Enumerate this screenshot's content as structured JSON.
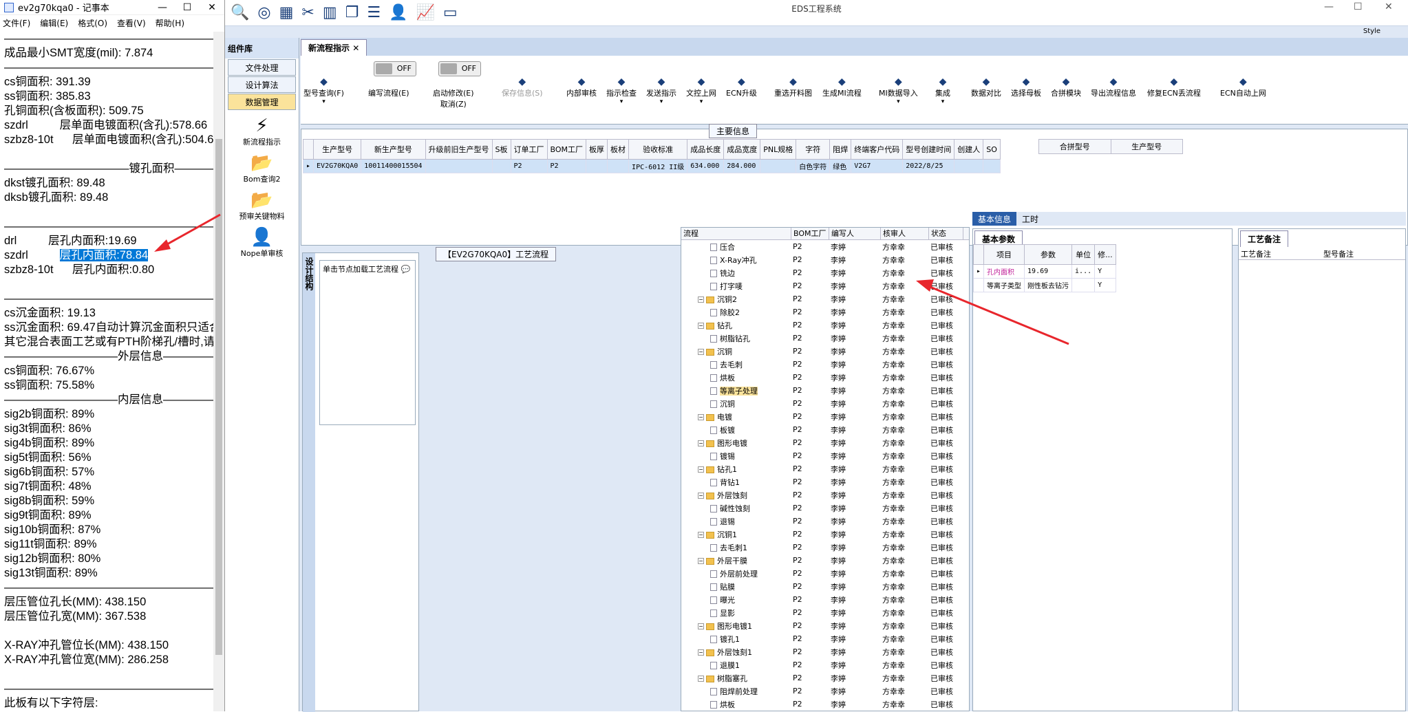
{
  "notepad": {
    "title": "ev2g70kqa0 - 记事本",
    "menu": [
      "文件(F)",
      "编辑(E)",
      "格式(O)",
      "查看(V)",
      "帮助(H)"
    ],
    "lines": [
      "——————————————————————————",
      "成品最小SMT宽度(mil): 7.874",
      "——————————————————————————",
      "cs铜面积: 391.39",
      "ss铜面积: 385.83",
      "孔铜面积(含板面积): 509.75",
      "szdrl          层单面电镀面积(含孔):578.66",
      "szbz8-10t      层单面电镀面积(含孔):504.6(",
      "",
      "———————————镀孔面积———————————",
      "dkst镀孔面积: 89.48",
      "dksb镀孔面积: 89.48",
      "",
      "——————————————————————————",
      "drl          层孔内面积:19.69",
      "szdrl          层孔内面积:78.84",
      "szbz8-10t      层孔内面积:0.80",
      "",
      "——————————————————————————",
      "cs沉金面积: 19.13",
      "ss沉金面积: 69.47自动计算沉金面积只适合",
      "其它混合表面工艺或有PTH阶梯孔/槽时,请",
      "——————————外层信息——————————",
      "cs铜面积: 76.67%",
      "ss铜面积: 75.58%",
      "——————————内层信息——————————",
      "sig2b铜面积: 89%",
      "sig3t铜面积: 86%",
      "sig4b铜面积: 89%",
      "sig5t铜面积: 56%",
      "sig6b铜面积: 57%",
      "sig7t铜面积: 48%",
      "sig8b铜面积: 59%",
      "sig9t铜面积: 89%",
      "sig10b铜面积: 87%",
      "sig11t铜面积: 89%",
      "sig12b铜面积: 80%",
      "sig13t铜面积: 89%",
      "——————————————————————————",
      "层压管位孔长(MM): 438.150",
      "层压管位孔宽(MM): 367.538",
      "",
      "X-RAY冲孔管位长(MM): 438.150",
      "X-RAY冲孔管位宽(MM): 286.258",
      "",
      "——————————————————————————",
      "此板有以下字符层:"
    ],
    "selected_line_index": 15,
    "selected_part": "层孔内面积:78.84"
  },
  "app": {
    "title": "EDS工程系统",
    "style_label": "Style",
    "sidebar": {
      "header": "组件库",
      "buttons": [
        "文件处理",
        "设计算法",
        "数据管理"
      ],
      "items": [
        "新流程指示",
        "Bom查询2",
        "预审关键物料",
        "Nope单审核"
      ]
    },
    "tab": "新流程指示",
    "ribbon": [
      {
        "label": "型号查询(F)"
      },
      {
        "label": "编写流程(E)"
      },
      {
        "label": "启动修改(E)\n取消(Z)"
      },
      {
        "label": "保存信息(S)"
      },
      {
        "label": "内部审核"
      },
      {
        "label": "指示检查"
      },
      {
        "label": "发送指示"
      },
      {
        "label": "文控上网"
      },
      {
        "label": "ECN升级"
      },
      {
        "label": "重选开料图"
      },
      {
        "label": "生成MI流程"
      },
      {
        "label": "MI数据导入"
      },
      {
        "label": "集成"
      },
      {
        "label": "数据对比"
      },
      {
        "label": "选择母板"
      },
      {
        "label": "合拼模块"
      },
      {
        "label": "导出流程信息"
      },
      {
        "label": "修复ECN丢流程"
      },
      {
        "label": "ECN自动上网"
      }
    ],
    "toggle_off": "OFF",
    "main_info": {
      "caption": "主要信息",
      "columns": [
        "生产型号",
        "新生产型号",
        "升级前旧生产型号",
        "S板",
        "订单工厂",
        "BOM工厂",
        "板厚",
        "板材",
        "验收标准",
        "成品长度",
        "成品宽度",
        "PNL规格",
        "字符",
        "阻焊",
        "终端客户代码",
        "型号创建时间",
        "创建人",
        "SO"
      ],
      "row": [
        "EV2G70KQA0",
        "10011400015504",
        "",
        "",
        "P2",
        "P2",
        "",
        "",
        "IPC-6012 II级",
        "634.000",
        "284.000",
        "",
        "白色字符",
        "绿色",
        "V2G7",
        "2022/8/25",
        "",
        ""
      ],
      "right_cols": [
        "合拼型号",
        "生产型号"
      ]
    },
    "flow": {
      "caption": "【EV2G70KQA0】工艺流程",
      "side_tab": "设计结构",
      "hint": "单击节点加载工艺流程",
      "cols": [
        "流程",
        "BOM工厂",
        "编写人",
        "核审人",
        "状态"
      ],
      "rows": [
        {
          "n": "压合",
          "i": 3,
          "f": 0
        },
        {
          "n": "X-Ray冲孔",
          "i": 3,
          "f": 0
        },
        {
          "n": "铣边",
          "i": 3,
          "f": 0
        },
        {
          "n": "打字唛",
          "i": 3,
          "f": 0
        },
        {
          "n": "沉铜2",
          "i": 2,
          "f": 1
        },
        {
          "n": "除胶2",
          "i": 3,
          "f": 0
        },
        {
          "n": "钻孔",
          "i": 2,
          "f": 1
        },
        {
          "n": "树脂钻孔",
          "i": 3,
          "f": 0
        },
        {
          "n": "沉铜",
          "i": 2,
          "f": 1
        },
        {
          "n": "去毛刺",
          "i": 3,
          "f": 0
        },
        {
          "n": "烘板",
          "i": 3,
          "f": 0
        },
        {
          "n": "等离子处理",
          "i": 3,
          "f": 0,
          "sel": 1
        },
        {
          "n": "沉铜",
          "i": 3,
          "f": 0
        },
        {
          "n": "电镀",
          "i": 2,
          "f": 1
        },
        {
          "n": "板镀",
          "i": 3,
          "f": 0
        },
        {
          "n": "图形电镀",
          "i": 2,
          "f": 1
        },
        {
          "n": "镀锡",
          "i": 3,
          "f": 0
        },
        {
          "n": "钻孔1",
          "i": 2,
          "f": 1
        },
        {
          "n": "背钻1",
          "i": 3,
          "f": 0
        },
        {
          "n": "外层蚀刻",
          "i": 2,
          "f": 1
        },
        {
          "n": "碱性蚀刻",
          "i": 3,
          "f": 0
        },
        {
          "n": "退锡",
          "i": 3,
          "f": 0
        },
        {
          "n": "沉铜1",
          "i": 2,
          "f": 1
        },
        {
          "n": "去毛刺1",
          "i": 3,
          "f": 0
        },
        {
          "n": "外层干膜",
          "i": 2,
          "f": 1
        },
        {
          "n": "外层前处理",
          "i": 3,
          "f": 0
        },
        {
          "n": "贴膜",
          "i": 3,
          "f": 0
        },
        {
          "n": "曝光",
          "i": 3,
          "f": 0
        },
        {
          "n": "显影",
          "i": 3,
          "f": 0
        },
        {
          "n": "图形电镀1",
          "i": 2,
          "f": 1
        },
        {
          "n": "镀孔1",
          "i": 3,
          "f": 0
        },
        {
          "n": "外层蚀刻1",
          "i": 2,
          "f": 1
        },
        {
          "n": "退膜1",
          "i": 3,
          "f": 0
        },
        {
          "n": "树脂塞孔",
          "i": 2,
          "f": 1
        },
        {
          "n": "阻焊前处理",
          "i": 3,
          "f": 0
        },
        {
          "n": "烘板",
          "i": 3,
          "f": 0
        }
      ],
      "bom": "P2",
      "writer": "李婷",
      "reviewer": "方幸幸",
      "status": "已审核"
    },
    "basic": {
      "tabs": [
        "基本信息",
        "工时"
      ],
      "sub": "基本参数",
      "cols": [
        "项目",
        "参数",
        "单位",
        "修..."
      ],
      "rows": [
        [
          "孔内面积",
          "19.69",
          "i...",
          "Y"
        ],
        [
          "等离子类型",
          "刚性板去钻污",
          "",
          "Y"
        ]
      ]
    },
    "remark": {
      "sub": "工艺备注",
      "cols": [
        "工艺备注",
        "型号备注"
      ]
    }
  }
}
